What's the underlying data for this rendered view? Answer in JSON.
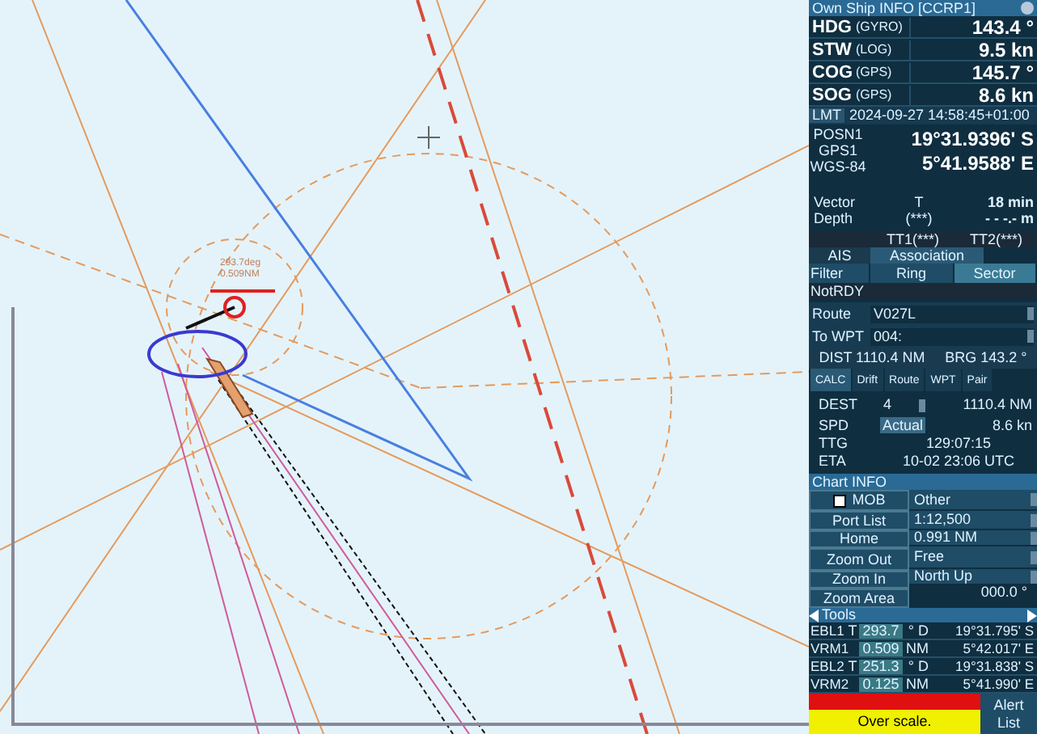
{
  "chart": {
    "vrm_label": [
      "293.7deg",
      "0.509NM"
    ]
  },
  "own_ship": {
    "title": "Own Ship INFO [CCRP1]",
    "sensors": [
      {
        "label": "HDG",
        "source": "(GYRO)",
        "value": "143.4 °"
      },
      {
        "label": "STW",
        "source": "(LOG)",
        "value": "9.5 kn"
      },
      {
        "label": "COG",
        "source": "(GPS)",
        "value": "145.7 °"
      },
      {
        "label": "SOG",
        "source": "(GPS)",
        "value": "8.6 kn"
      }
    ],
    "lmt": {
      "label": "LMT",
      "value": "2024-09-27 14:58:45+01:00"
    },
    "position": {
      "labels": [
        "POSN1",
        "GPS1",
        "WGS-84"
      ],
      "lat": "19°31.9396' S",
      "lon": "5°41.9588' E"
    },
    "vector": {
      "label": "Vector",
      "mode": "T",
      "value": "18 min"
    },
    "depth": {
      "label": "Depth",
      "source": "(***)",
      "value": "- - -.- m"
    }
  },
  "targets": {
    "headers": [
      "TT1(***)",
      "TT2(***)"
    ],
    "tabs": [
      {
        "label": "AIS",
        "selected": false
      },
      {
        "label": "Association",
        "selected": true
      }
    ],
    "filters": [
      {
        "label": "Filter",
        "selected": false
      },
      {
        "label": "Ring",
        "selected": false
      },
      {
        "label": "Sector",
        "selected": true
      }
    ],
    "status": "NotRDY"
  },
  "route": {
    "fields": [
      {
        "label": "Route",
        "value": "V027L"
      },
      {
        "label": "To WPT",
        "value": "004:"
      }
    ],
    "dist": "DIST 1110.4 NM",
    "brg": "BRG 143.2 °",
    "tabs": [
      {
        "label": "CALC",
        "selected": true
      },
      {
        "label": "Drift",
        "selected": false
      },
      {
        "label": "Route",
        "selected": false
      },
      {
        "label": "WPT",
        "selected": false
      },
      {
        "label": "Pair",
        "selected": false
      }
    ],
    "dest": {
      "label": "DEST",
      "value": "4",
      "reading": "1110.4 NM"
    },
    "spd": {
      "label": "SPD",
      "mode": "Actual",
      "reading": "8.6 kn"
    },
    "ttg": {
      "label": "TTG",
      "reading": "129:07:15"
    },
    "eta": {
      "label": "ETA",
      "reading": "10-02 23:06 UTC"
    }
  },
  "chart_info": {
    "title": "Chart INFO",
    "buttons": [
      "MOB",
      "Port List",
      "Home",
      "Zoom Out",
      "Zoom In",
      "Zoom Area"
    ],
    "selects": [
      "Other",
      "1:12,500",
      "0.991 NM",
      "Free",
      "North Up"
    ],
    "bearing": "000.0 °"
  },
  "tools": {
    "title": "Tools",
    "rows": [
      {
        "label": "EBL1",
        "mode": "T",
        "value": "293.7",
        "unit": "° D",
        "position": "19°31.795' S"
      },
      {
        "label": "VRM1",
        "mode": "",
        "value": "0.509",
        "unit": "NM",
        "position": "5°42.017' E"
      },
      {
        "label": "EBL2",
        "mode": "T",
        "value": "251.3",
        "unit": "° D",
        "position": "19°31.838' S"
      },
      {
        "label": "VRM2",
        "mode": "",
        "value": "0.125",
        "unit": "NM",
        "position": "5°41.990' E"
      }
    ]
  },
  "alert": {
    "message": "Over scale.",
    "button": "Alert List"
  }
}
